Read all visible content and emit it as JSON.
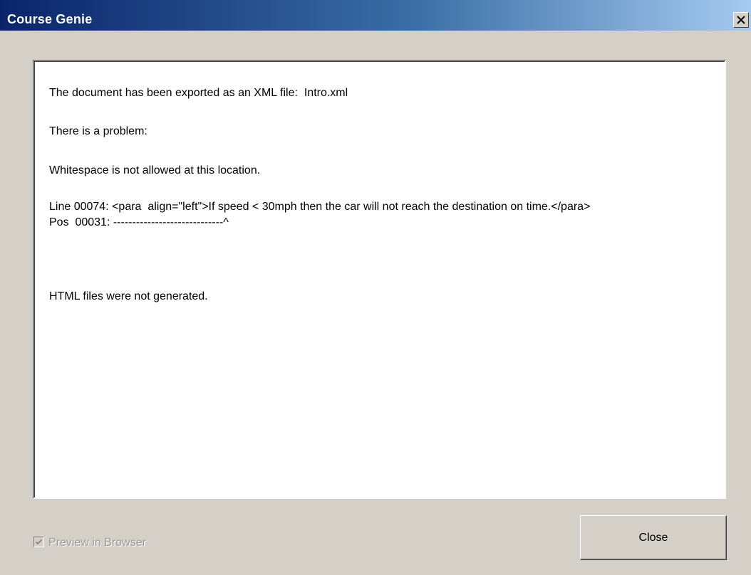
{
  "window": {
    "title": "Course Genie",
    "close_glyph": "close-icon"
  },
  "message": {
    "line1": "The document has been exported as an XML file:  Intro.xml",
    "line2": "There is a problem:",
    "line3": "Whitespace is not allowed at this location.",
    "line4": "Line 00074: <para  align=\"left\">If speed < 30mph then the car will not reach the destination on time.</para>\nPos  00031: -----------------------------^",
    "line5": "HTML files were not generated."
  },
  "controls": {
    "preview_label": "Preview in Browser",
    "preview_checked": true,
    "preview_disabled": true,
    "close_label": "Close"
  },
  "colors": {
    "title_start": "#0a246a",
    "title_end": "#a6caf0",
    "face": "#d4d0c8"
  }
}
